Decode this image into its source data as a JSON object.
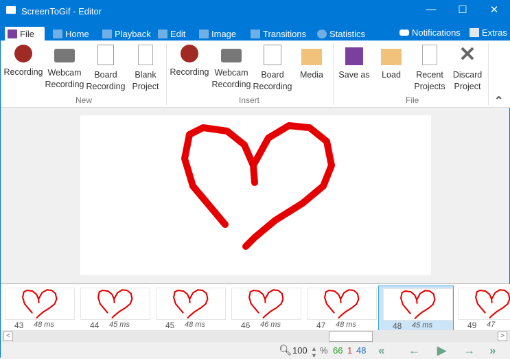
{
  "window": {
    "title": "ScreenToGif - Editor",
    "minimize": "—",
    "maximize": "☐",
    "close": "✕"
  },
  "tabs": [
    {
      "label": "File"
    },
    {
      "label": "Home"
    },
    {
      "label": "Playback"
    },
    {
      "label": "Edit"
    },
    {
      "label": "Image"
    },
    {
      "label": "Transitions"
    },
    {
      "label": "Statistics"
    }
  ],
  "extras": {
    "notifications": "Notifications",
    "extras": "Extras"
  },
  "ribbon": {
    "new": {
      "label": "New",
      "items": [
        {
          "l1": "Recording",
          "l2": ""
        },
        {
          "l1": "Webcam",
          "l2": "Recording"
        },
        {
          "l1": "Board",
          "l2": "Recording"
        },
        {
          "l1": "Blank",
          "l2": "Project"
        }
      ]
    },
    "insert": {
      "label": "Insert",
      "items": [
        {
          "l1": "Recording",
          "l2": ""
        },
        {
          "l1": "Webcam",
          "l2": "Recording"
        },
        {
          "l1": "Board",
          "l2": "Recording"
        },
        {
          "l1": "Media",
          "l2": ""
        }
      ]
    },
    "file": {
      "label": "File",
      "items": [
        {
          "l1": "Save as",
          "l2": ""
        },
        {
          "l1": "Load",
          "l2": ""
        },
        {
          "l1": "Recent",
          "l2": "Projects"
        },
        {
          "l1": "Discard",
          "l2": "Project"
        }
      ]
    },
    "collapse": "⌃"
  },
  "frames": [
    {
      "num": "43",
      "ms": "48 ms"
    },
    {
      "num": "44",
      "ms": "45 ms"
    },
    {
      "num": "45",
      "ms": "48 ms"
    },
    {
      "num": "46",
      "ms": "46 ms"
    },
    {
      "num": "47",
      "ms": "48 ms"
    },
    {
      "num": "48",
      "ms": "45 ms",
      "selected": true
    },
    {
      "num": "49",
      "ms": "47"
    }
  ],
  "status": {
    "zoom": "100",
    "percent": "%",
    "total": "66",
    "selected_count": "1",
    "current": "48",
    "colors": {
      "total": "#2a9d2a",
      "selected": "#c0392b",
      "current": "#1e6fc2"
    }
  }
}
